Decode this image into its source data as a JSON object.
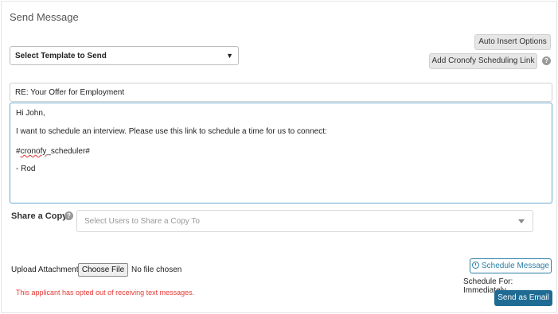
{
  "title": "Send Message",
  "template_select": {
    "value": "Select Template to Send"
  },
  "buttons": {
    "auto_insert": "Auto Insert Options",
    "add_cronofy": "Add Cronofy Scheduling Link",
    "choose_file": "Choose File",
    "schedule_message": "Schedule Message",
    "send_as_email": "Send as Email"
  },
  "help_icon_glyph": "?",
  "subject": {
    "value": "RE: Your Offer for Employment"
  },
  "message_body": {
    "greeting": "Hi John,",
    "line1": "I want to schedule an interview. Please use this link to schedule a time for us to connect:",
    "token": "#cronofy_scheduler#",
    "signature": "- Rod"
  },
  "share": {
    "label": "Share a Copy",
    "placeholder": "Select Users to Share a Copy To"
  },
  "upload": {
    "label": "Upload Attachment",
    "no_file": "No file chosen"
  },
  "opt_out_warning": "This applicant has opted out of receiving text messages.",
  "schedule_for": "Schedule For: Immediately",
  "colors": {
    "primary": "#1f6b93",
    "link": "#2a7ea6",
    "warning": "#e53935",
    "focus_border": "#6aa9cf"
  },
  "icons": [
    "chevron-down-icon",
    "help-icon",
    "caret-down-icon",
    "clock-icon"
  ]
}
